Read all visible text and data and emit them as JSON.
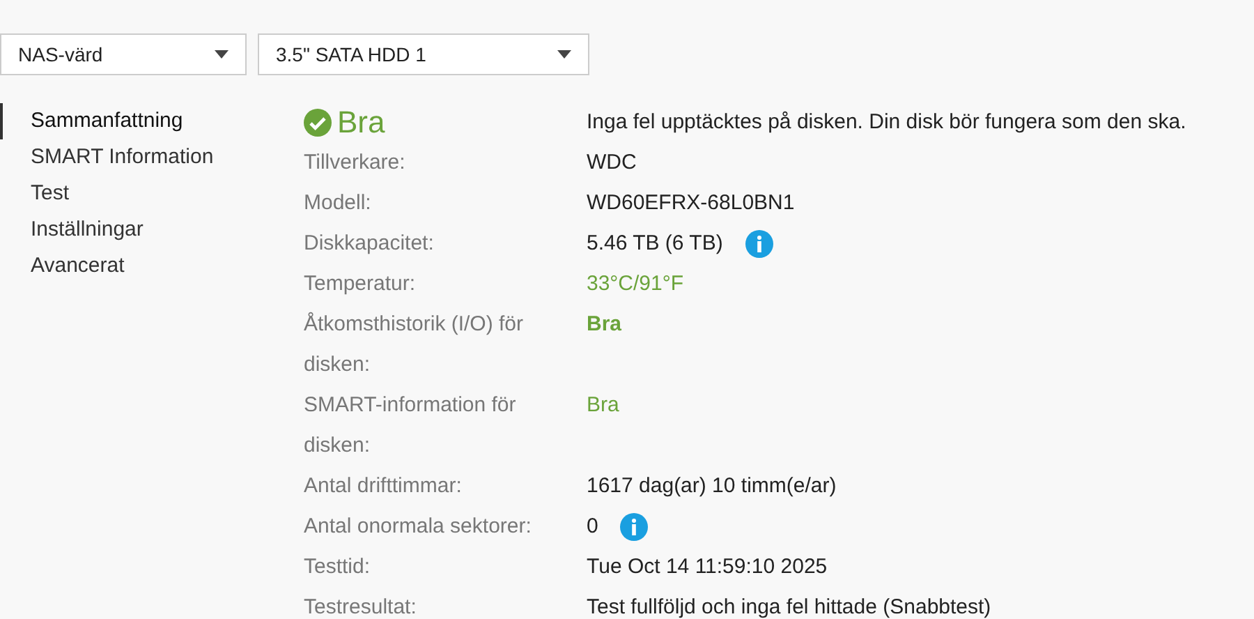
{
  "selectors": [
    {
      "value": "NAS-värd"
    },
    {
      "value": "3.5\" SATA HDD 1"
    }
  ],
  "nav": [
    {
      "label": "Sammanfattning",
      "selected": true
    },
    {
      "label": "SMART Information",
      "selected": false
    },
    {
      "label": "Test",
      "selected": false
    },
    {
      "label": "Inställningar",
      "selected": false
    },
    {
      "label": "Avancerat",
      "selected": false
    }
  ],
  "status": {
    "label": "Bra",
    "good": true,
    "message": "Inga fel upptäcktes på disken. Din disk bör fungera som den ska."
  },
  "rows": [
    {
      "label": "Tillverkare:",
      "value": "WDC",
      "kind": "plain",
      "info": false
    },
    {
      "label": "Modell:",
      "value": "WD60EFRX-68L0BN1",
      "kind": "plain",
      "info": false
    },
    {
      "label": "Diskkapacitet:",
      "value": "5.46 TB (6 TB)",
      "kind": "plain",
      "info": true
    },
    {
      "label": "Temperatur:",
      "value": "33°C/91°F",
      "kind": "good",
      "info": false
    },
    {
      "label": "Åtkomsthistorik (I/O) för disken:",
      "value": "Bra",
      "kind": "strong",
      "info": false
    },
    {
      "label": "SMART-information för disken:",
      "value": "Bra",
      "kind": "good",
      "info": false
    },
    {
      "label": "Antal drifttimmar:",
      "value": "1617 dag(ar) 10 timm(e/ar)",
      "kind": "plain",
      "info": false
    },
    {
      "label": "Antal onormala sektorer:",
      "value": "0",
      "kind": "plain",
      "info": true
    },
    {
      "label": "Testtid:",
      "value": "Tue Oct 14 11:59:10 2025",
      "kind": "plain",
      "info": false
    },
    {
      "label": "Testresultat:",
      "value": "Test fullföljd och inga fel hittade (Snabbtest)",
      "kind": "plain",
      "info": false
    }
  ]
}
